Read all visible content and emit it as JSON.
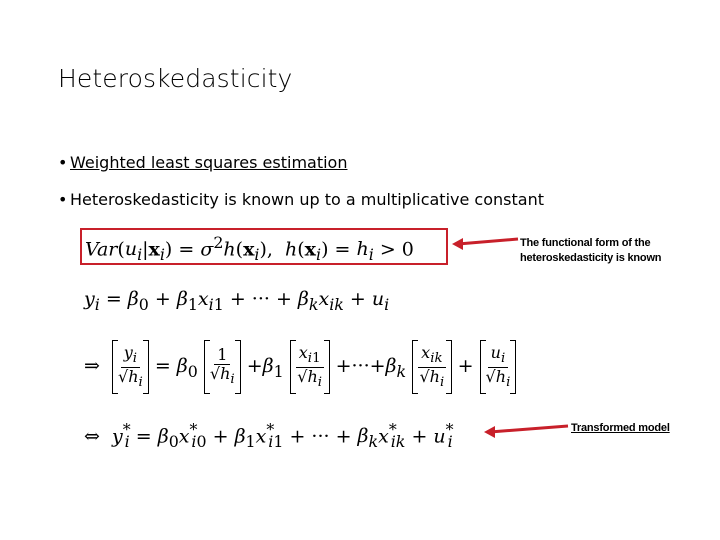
{
  "slide": {
    "title": "Heteroskedasticity",
    "bullets": [
      {
        "text": "Weighted least squares estimation",
        "underlined": true
      },
      {
        "text": "Heteroskedasticity is known up to a multiplicative constant",
        "underlined": false
      }
    ],
    "bullet_glyph": "•",
    "equations": {
      "variance": "Var(u_i|x_i) = σ²h(x_i),  h(x_i) = h_i > 0",
      "model": "y_i = β_0 + β_1 x_i1 + ··· + β_k x_ik + u_i",
      "weighted": "⇒ [y_i/√h_i] = β_0[1/√h_i] + β_1[x_i1/√h_i] + ··· + β_k[x_ik/√h_i] + [u_i/√h_i]",
      "transformed": "⇔ y_i* = β_0 x_i0* + β_1 x_i1* + ··· + β_k x_ik* + u_i*"
    },
    "annotations": [
      {
        "text_line1": "The functional form of the",
        "text_line2": "heteroskedasticity is known",
        "icon": "arrow-left-icon"
      },
      {
        "text": "Transformed model",
        "icon": "arrow-left-icon"
      }
    ],
    "colors": {
      "highlight": "#c8202a",
      "text": "#000000",
      "background": "#ffffff"
    }
  }
}
